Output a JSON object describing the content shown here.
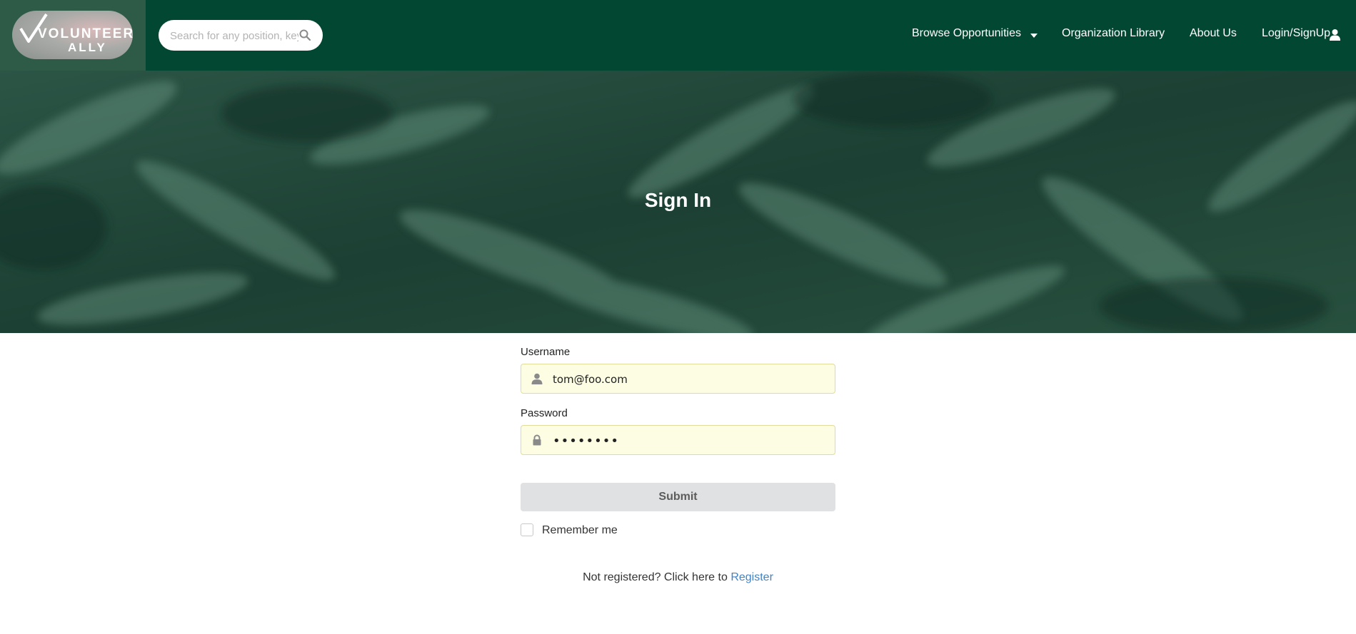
{
  "brand": {
    "logo_line1": "VOLUNTEER",
    "logo_line2": "ALLY"
  },
  "search": {
    "placeholder": "Search for any position, keyword, or organization",
    "icon": "search-icon"
  },
  "nav": {
    "items": [
      {
        "label": "Browse Opportunities",
        "icon": "chevron-down-icon"
      },
      {
        "label": "Organization Library"
      },
      {
        "label": "About Us"
      },
      {
        "label": "Login/SignUp",
        "icon": "user-icon"
      }
    ]
  },
  "hero": {
    "title": "Sign In"
  },
  "form": {
    "username_label": "Username",
    "username_value": "tom@foo.com",
    "username_icon": "user-icon",
    "password_label": "Password",
    "password_mask": "••••••••",
    "password_icon": "lock-icon",
    "submit_label": "Submit",
    "remember_label": "Remember me",
    "remember_checked": false,
    "register_prompt": "Not registered? Click here to",
    "register_link": "Register"
  },
  "colors": {
    "navbar": "#024731",
    "link": "#4183c4",
    "field_bg": "#fdfde4"
  }
}
